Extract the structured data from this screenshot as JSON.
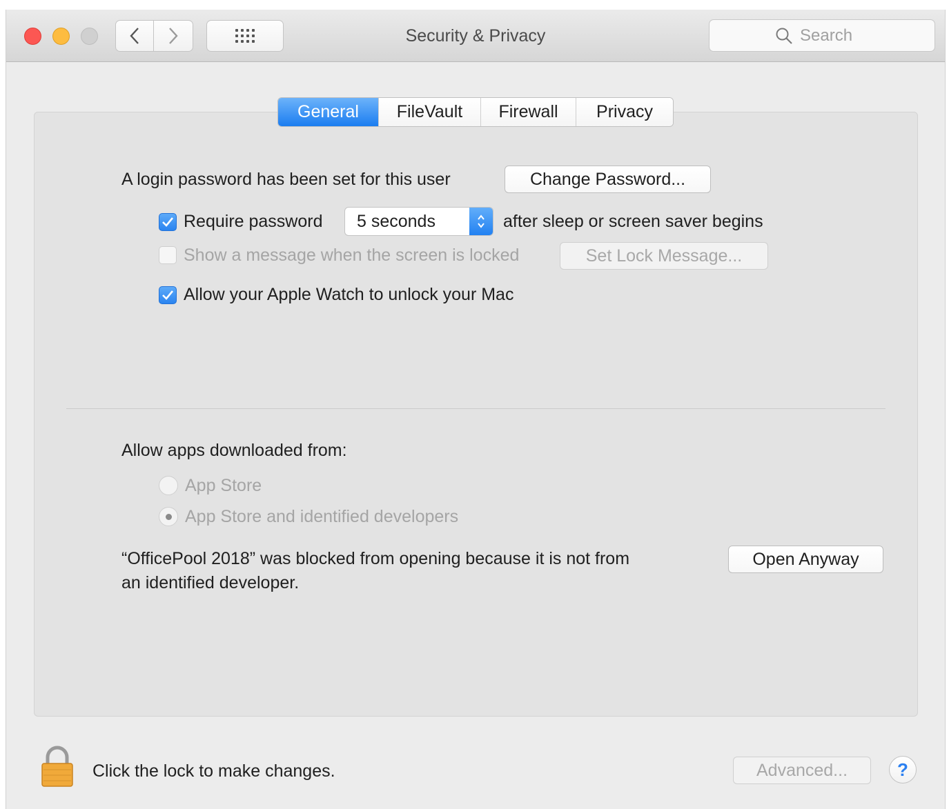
{
  "window": {
    "title": "Security & Privacy"
  },
  "toolbar": {
    "search": {
      "placeholder": "Search",
      "value": ""
    }
  },
  "tabs": [
    {
      "label": "General",
      "selected": true
    },
    {
      "label": "FileVault",
      "selected": false
    },
    {
      "label": "Firewall",
      "selected": false
    },
    {
      "label": "Privacy",
      "selected": false
    }
  ],
  "general": {
    "login_text": "A login password has been set for this user",
    "change_password_label": "Change Password...",
    "require_password": {
      "label": "Require password",
      "checked": true,
      "delay_value": "5 seconds",
      "suffix": "after sleep or screen saver begins"
    },
    "lock_message": {
      "label": "Show a message when the screen is locked",
      "checked": false,
      "enabled": false,
      "button_label": "Set Lock Message..."
    },
    "apple_watch": {
      "label": "Allow your Apple Watch to unlock your Mac",
      "checked": true
    },
    "allow_apps": {
      "heading": "Allow apps downloaded from:",
      "options": [
        {
          "label": "App Store",
          "selected": false
        },
        {
          "label": "App Store and identified developers",
          "selected": true
        }
      ],
      "enabled": false
    },
    "blocked": {
      "line1": "“OfficePool 2018” was blocked from opening because it is not from",
      "line2": "an identified developer.",
      "button_label": "Open Anyway"
    }
  },
  "footer": {
    "lock_text": "Click the lock to make changes.",
    "advanced_label": "Advanced...",
    "help_label": "?"
  },
  "colors": {
    "accent": "#2a84f0",
    "close": "#fc5753",
    "minimize": "#fdbc40",
    "lock": "#f0a93a"
  }
}
